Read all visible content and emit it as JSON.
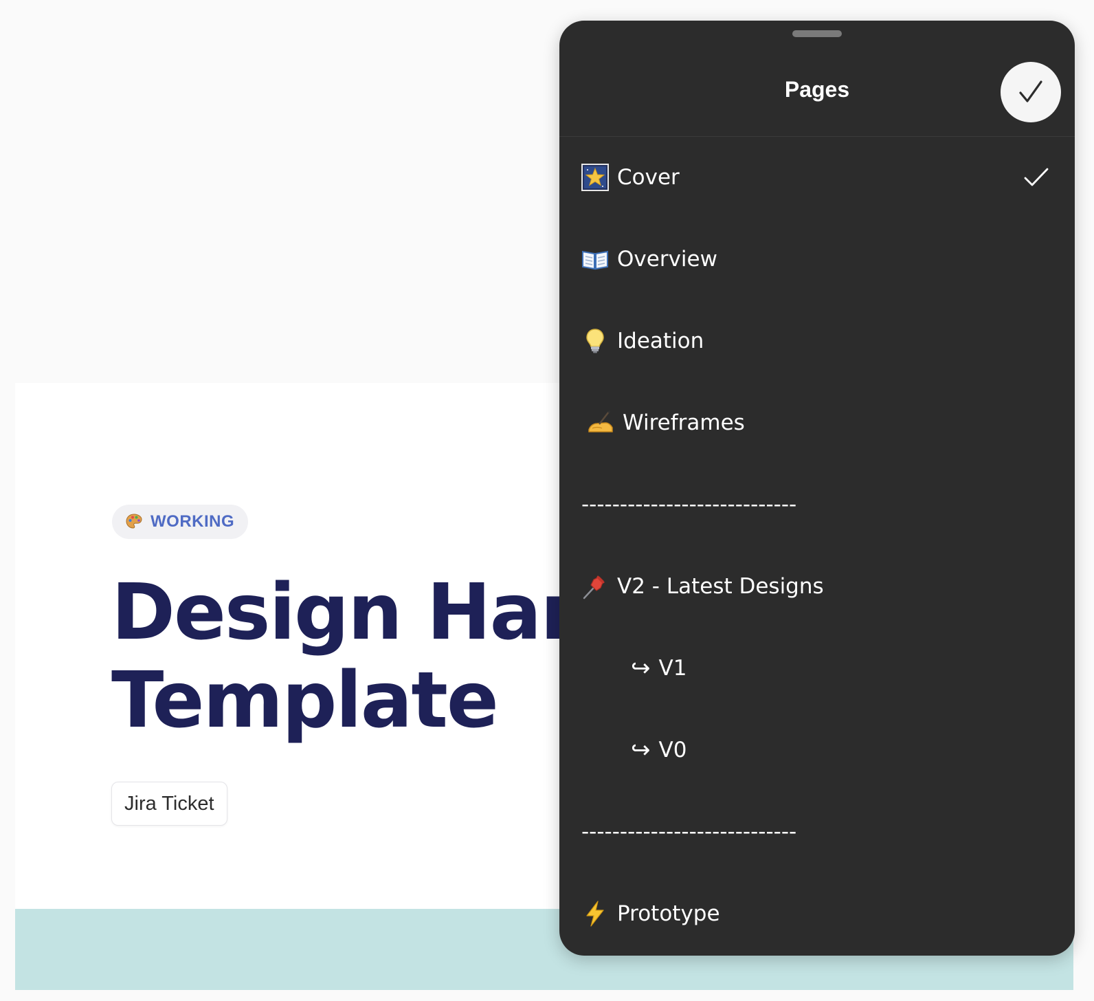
{
  "cover": {
    "status_label": "WORKING",
    "title_line1": "Design Handoff",
    "title_line2": "Template",
    "link_label": "Jira Ticket",
    "colors": {
      "title": "#1e2157",
      "status_text": "#4f6bc4",
      "band": "#c3e3e3"
    }
  },
  "pages_sheet": {
    "title": "Pages",
    "done_icon": "checkmark-icon",
    "items": [
      {
        "label": "Cover",
        "icon": "cover-star-icon",
        "selected": true
      },
      {
        "label": "Overview",
        "icon": "open-book-icon"
      },
      {
        "label": "Ideation",
        "icon": "lightbulb-icon"
      },
      {
        "label": "Wireframes",
        "icon": "writing-hand-icon"
      },
      {
        "label": "----------------------------"
      },
      {
        "label": "V2 - Latest Designs",
        "icon": "pushpin-icon"
      },
      {
        "label": "V1",
        "icon": "return-arrow-icon"
      },
      {
        "label": "V0",
        "icon": "return-arrow-icon"
      },
      {
        "label": "----------------------------"
      },
      {
        "label": "Prototype",
        "icon": "lightning-icon"
      }
    ],
    "colors": {
      "sheet_bg": "#2c2c2c",
      "text": "#ffffff"
    }
  }
}
